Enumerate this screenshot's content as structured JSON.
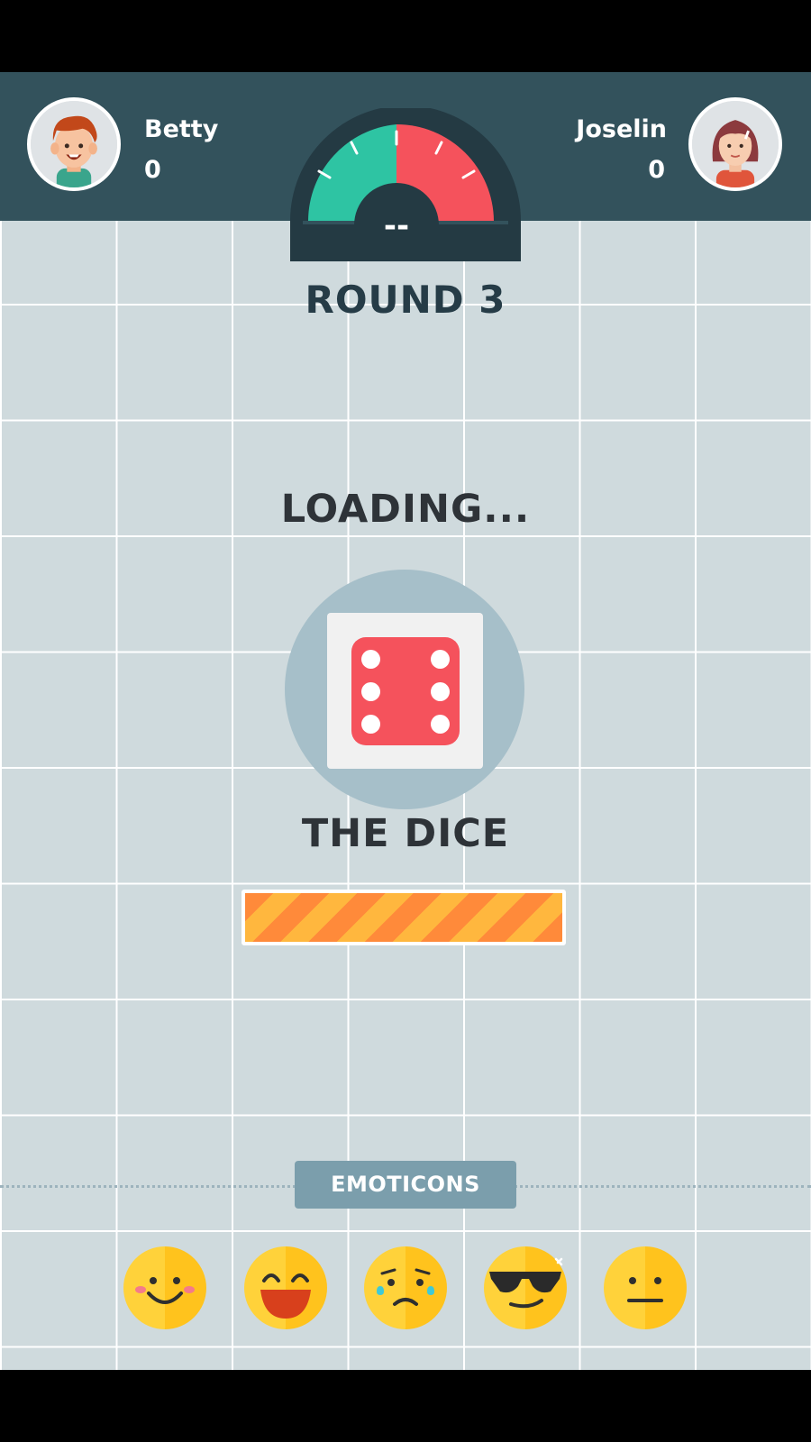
{
  "players": {
    "left": {
      "name": "Betty",
      "score": "0"
    },
    "right": {
      "name": "Joselin",
      "score": "0"
    }
  },
  "gauge": {
    "center_label": "--",
    "left_color": "#2ec4a3",
    "right_color": "#f5525c"
  },
  "round_label": "ROUND 3",
  "loading_label": "LOADING...",
  "dice": {
    "face_value": 6,
    "color": "#f5525c"
  },
  "game_name": "THE DICE",
  "progress": {
    "fraction": 1.0
  },
  "emoticons": {
    "label": "EMOTICONS",
    "items": [
      {
        "icon": "smiling-blush-emoji-icon"
      },
      {
        "icon": "laughing-emoji-icon"
      },
      {
        "icon": "crying-emoji-icon"
      },
      {
        "icon": "sunglasses-emoji-icon"
      },
      {
        "icon": "neutral-emoji-icon"
      }
    ]
  },
  "colors": {
    "header": "#33525c",
    "background": "#cfdadd",
    "accent_orange": "#ff8a3a",
    "button": "#7b9eac"
  }
}
